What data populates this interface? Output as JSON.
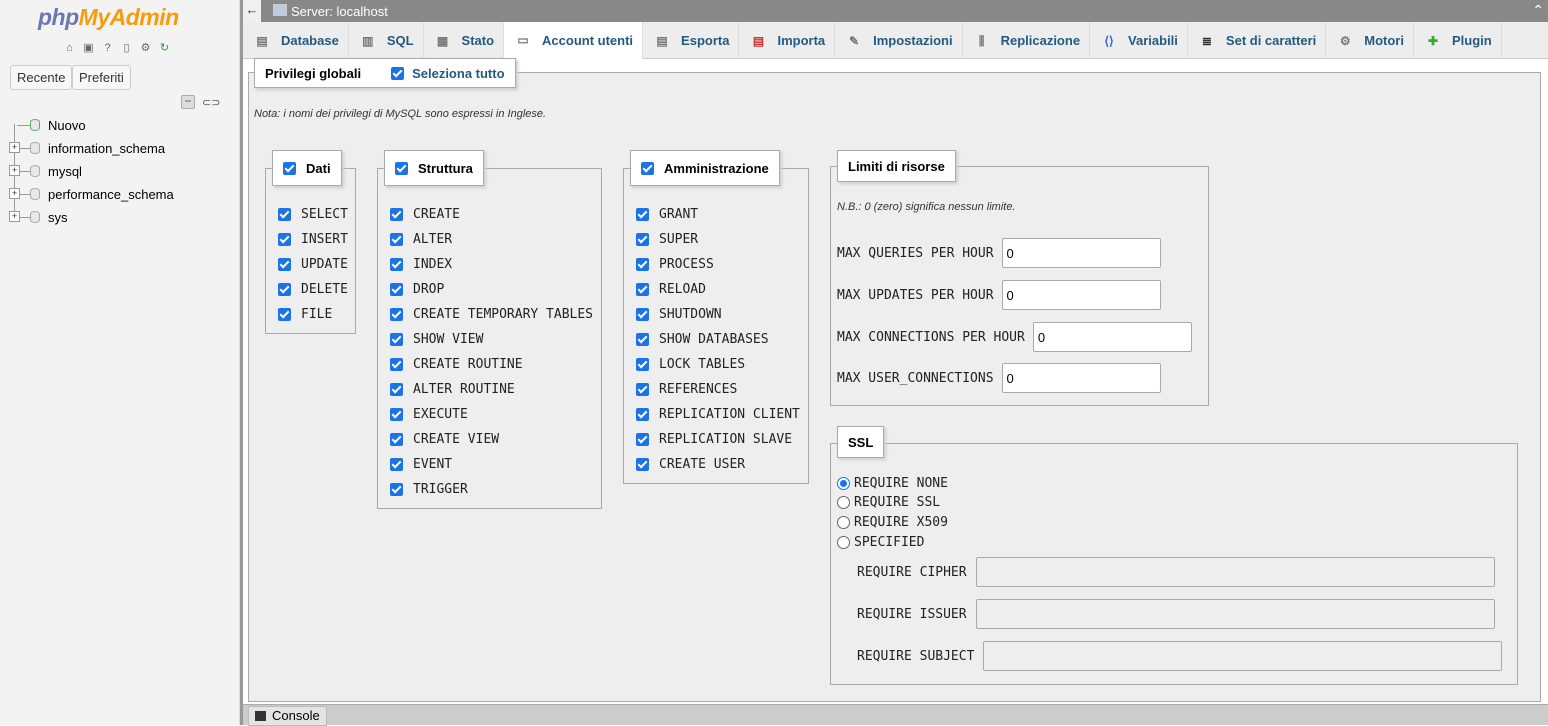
{
  "logo": {
    "part1": "php",
    "part2": "MyAdmin"
  },
  "nav": {
    "icons": [
      "home-icon",
      "logout-icon",
      "help-icon",
      "docs-icon",
      "settings-icon",
      "reload-icon"
    ],
    "recent": "Recente",
    "favorites": "Preferiti",
    "tree": [
      {
        "label": "Nuovo",
        "type": "new"
      },
      {
        "label": "information_schema",
        "type": "db"
      },
      {
        "label": "mysql",
        "type": "db"
      },
      {
        "label": "performance_schema",
        "type": "db"
      },
      {
        "label": "sys",
        "type": "db"
      }
    ]
  },
  "topbar": {
    "server": "Server: localhost"
  },
  "tabs": [
    {
      "label": "Database",
      "icon": "database-icon"
    },
    {
      "label": "SQL",
      "icon": "sql-icon"
    },
    {
      "label": "Stato",
      "icon": "status-icon"
    },
    {
      "label": "Account utenti",
      "icon": "users-icon",
      "active": true
    },
    {
      "label": "Esporta",
      "icon": "export-icon"
    },
    {
      "label": "Importa",
      "icon": "import-icon"
    },
    {
      "label": "Impostazioni",
      "icon": "settings-icon"
    },
    {
      "label": "Replicazione",
      "icon": "replication-icon"
    },
    {
      "label": "Variabili",
      "icon": "variables-icon"
    },
    {
      "label": "Set di caratteri",
      "icon": "charset-icon"
    },
    {
      "label": "Motori",
      "icon": "engines-icon"
    },
    {
      "label": "Plugin",
      "icon": "plugin-icon"
    }
  ],
  "global": {
    "title": "Privilegi globali",
    "select_all": "Seleziona tutto",
    "note": "Nota: i nomi dei privilegi di MySQL sono espressi in Inglese."
  },
  "data_group": {
    "title": "Dati",
    "items": [
      "SELECT",
      "INSERT",
      "UPDATE",
      "DELETE",
      "FILE"
    ]
  },
  "structure_group": {
    "title": "Struttura",
    "items": [
      "CREATE",
      "ALTER",
      "INDEX",
      "DROP",
      "CREATE TEMPORARY TABLES",
      "SHOW VIEW",
      "CREATE ROUTINE",
      "ALTER ROUTINE",
      "EXECUTE",
      "CREATE VIEW",
      "EVENT",
      "TRIGGER"
    ]
  },
  "admin_group": {
    "title": "Amministrazione",
    "items": [
      "GRANT",
      "SUPER",
      "PROCESS",
      "RELOAD",
      "SHUTDOWN",
      "SHOW DATABASES",
      "LOCK TABLES",
      "REFERENCES",
      "REPLICATION CLIENT",
      "REPLICATION SLAVE",
      "CREATE USER"
    ]
  },
  "limits": {
    "title": "Limiti di risorse",
    "note": "N.B.: 0 (zero) significa nessun limite.",
    "fields": [
      {
        "label": "MAX QUERIES PER HOUR",
        "value": "0"
      },
      {
        "label": "MAX UPDATES PER HOUR",
        "value": "0"
      },
      {
        "label": "MAX CONNECTIONS PER HOUR",
        "value": "0"
      },
      {
        "label": "MAX USER_CONNECTIONS",
        "value": "0"
      }
    ]
  },
  "ssl": {
    "title": "SSL",
    "options": [
      "REQUIRE NONE",
      "REQUIRE SSL",
      "REQUIRE X509",
      "SPECIFIED"
    ],
    "selected": "REQUIRE NONE",
    "fields": [
      {
        "label": "REQUIRE CIPHER",
        "value": ""
      },
      {
        "label": "REQUIRE ISSUER",
        "value": ""
      },
      {
        "label": "REQUIRE SUBJECT",
        "value": ""
      }
    ]
  },
  "console": {
    "label": "Console"
  }
}
